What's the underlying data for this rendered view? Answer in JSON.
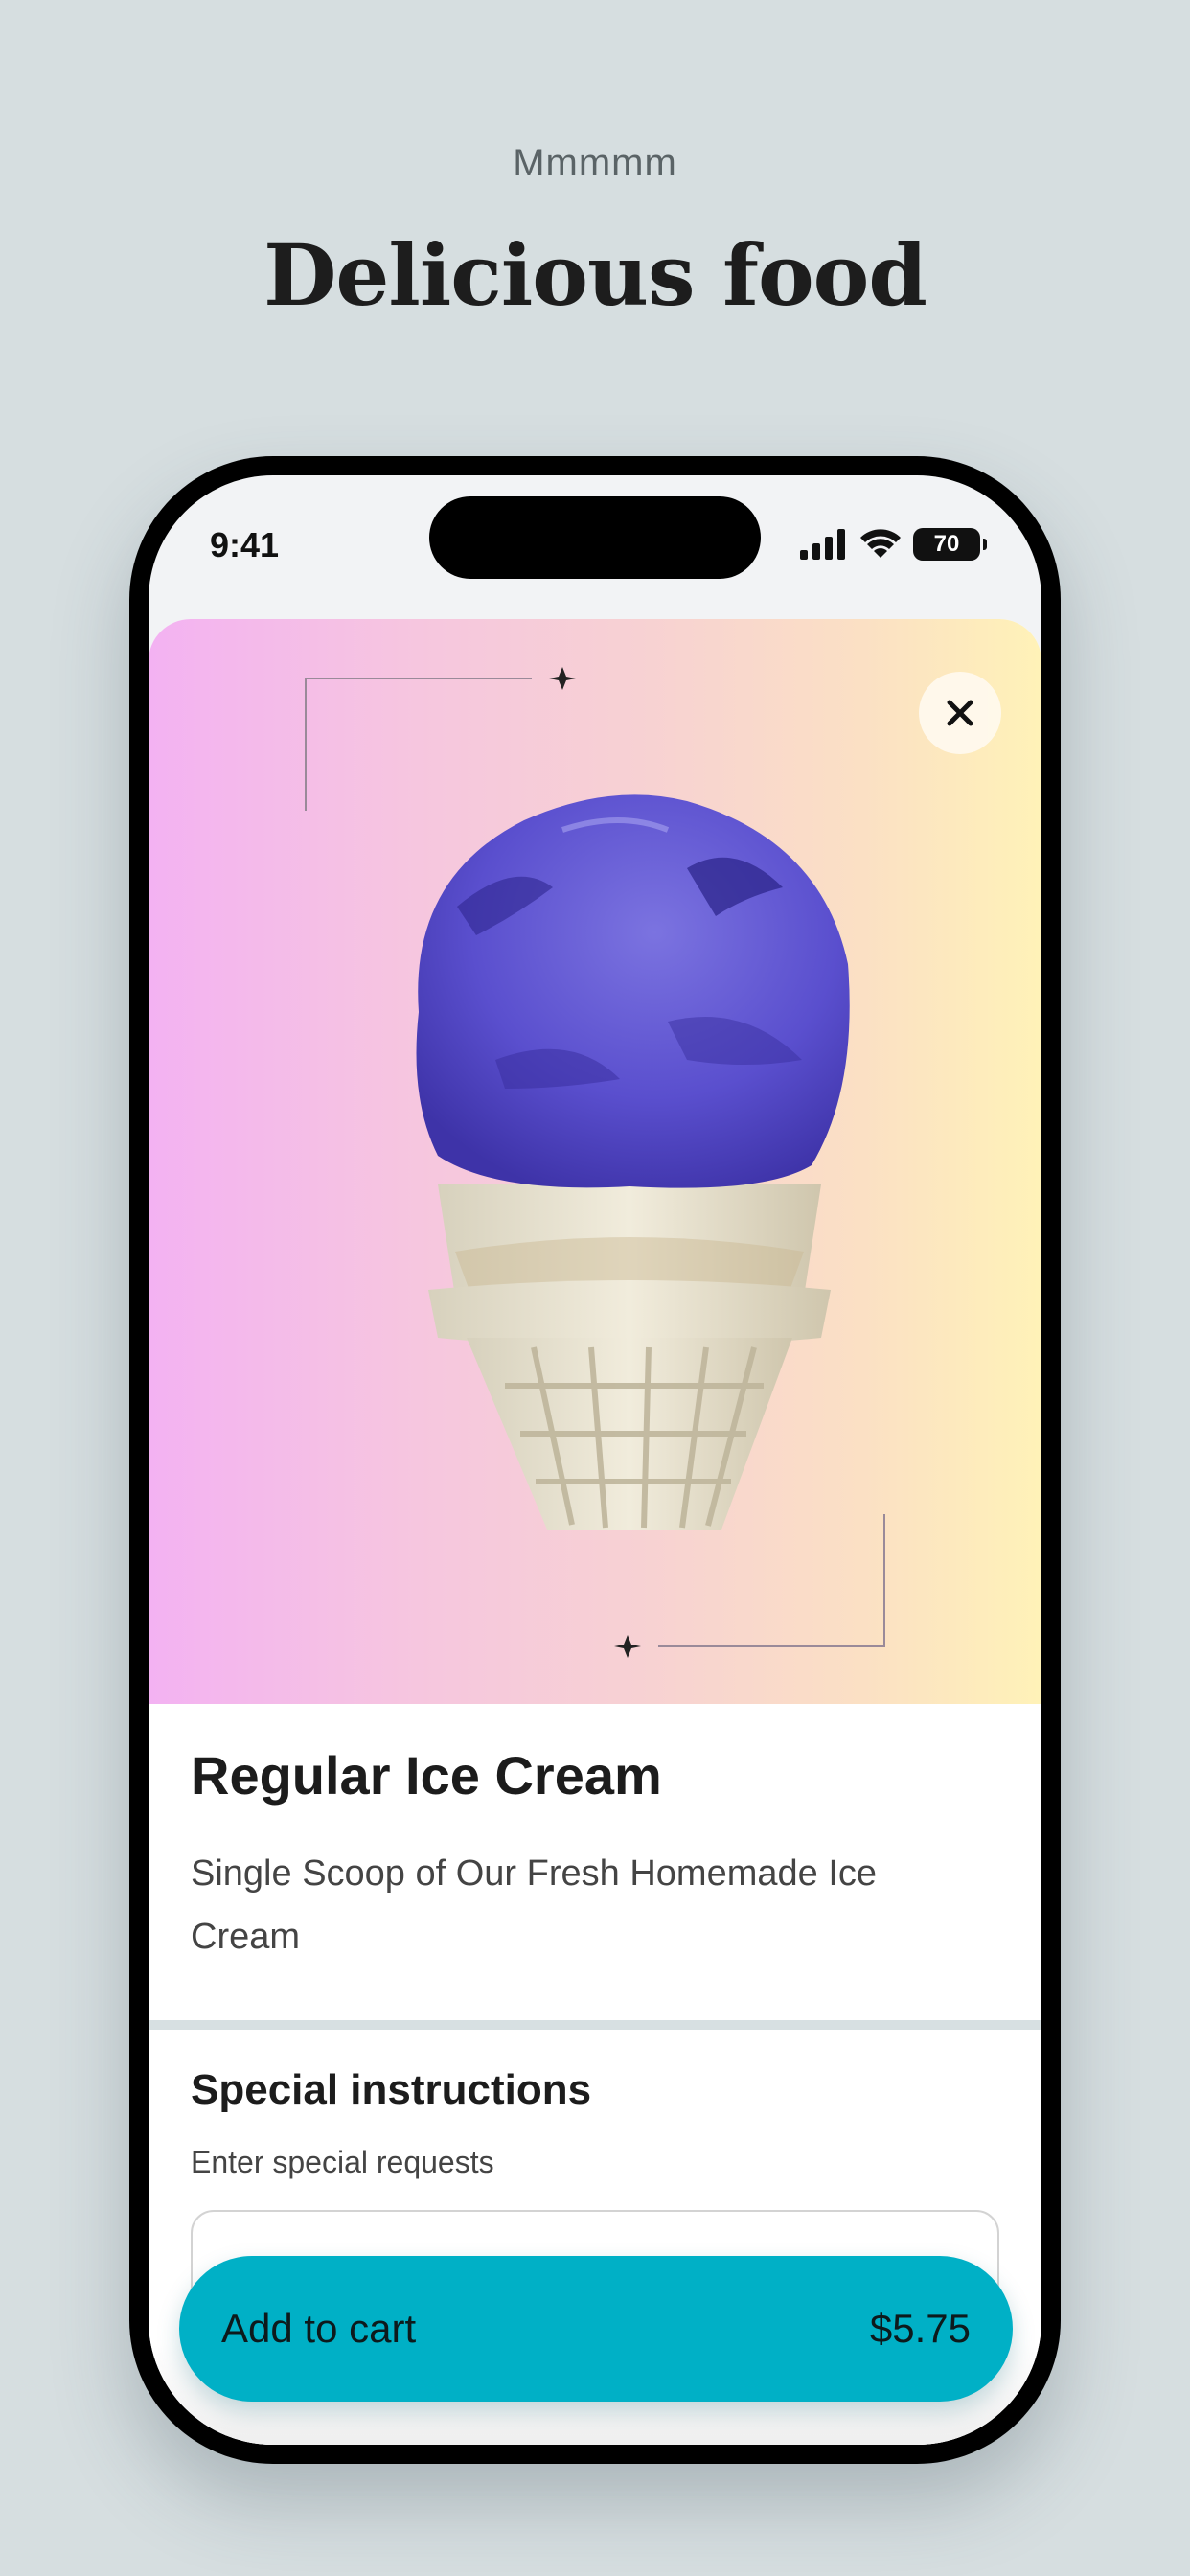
{
  "promo": {
    "eyebrow": "Mmmmm",
    "title": "Delicious food"
  },
  "status_bar": {
    "time": "9:41",
    "battery": "70",
    "icons": [
      "signal-icon",
      "wifi-icon",
      "battery-icon"
    ]
  },
  "product": {
    "title": "Regular Ice Cream",
    "description": "Single Scoop of Our Fresh Homemade Ice Cream",
    "image": "ice-cream-cone-image",
    "hero_gradient": [
      "#f3b2f2",
      "#f7d1d3",
      "#fff2b8"
    ]
  },
  "special_instructions": {
    "title": "Special instructions",
    "hint": "Enter special requests",
    "value": ""
  },
  "cart_button": {
    "label": "Add to cart",
    "price": "$5.75",
    "color": "#00b0c6"
  },
  "colors": {
    "background": "#d6dee0",
    "accent": "#00b0c6"
  }
}
